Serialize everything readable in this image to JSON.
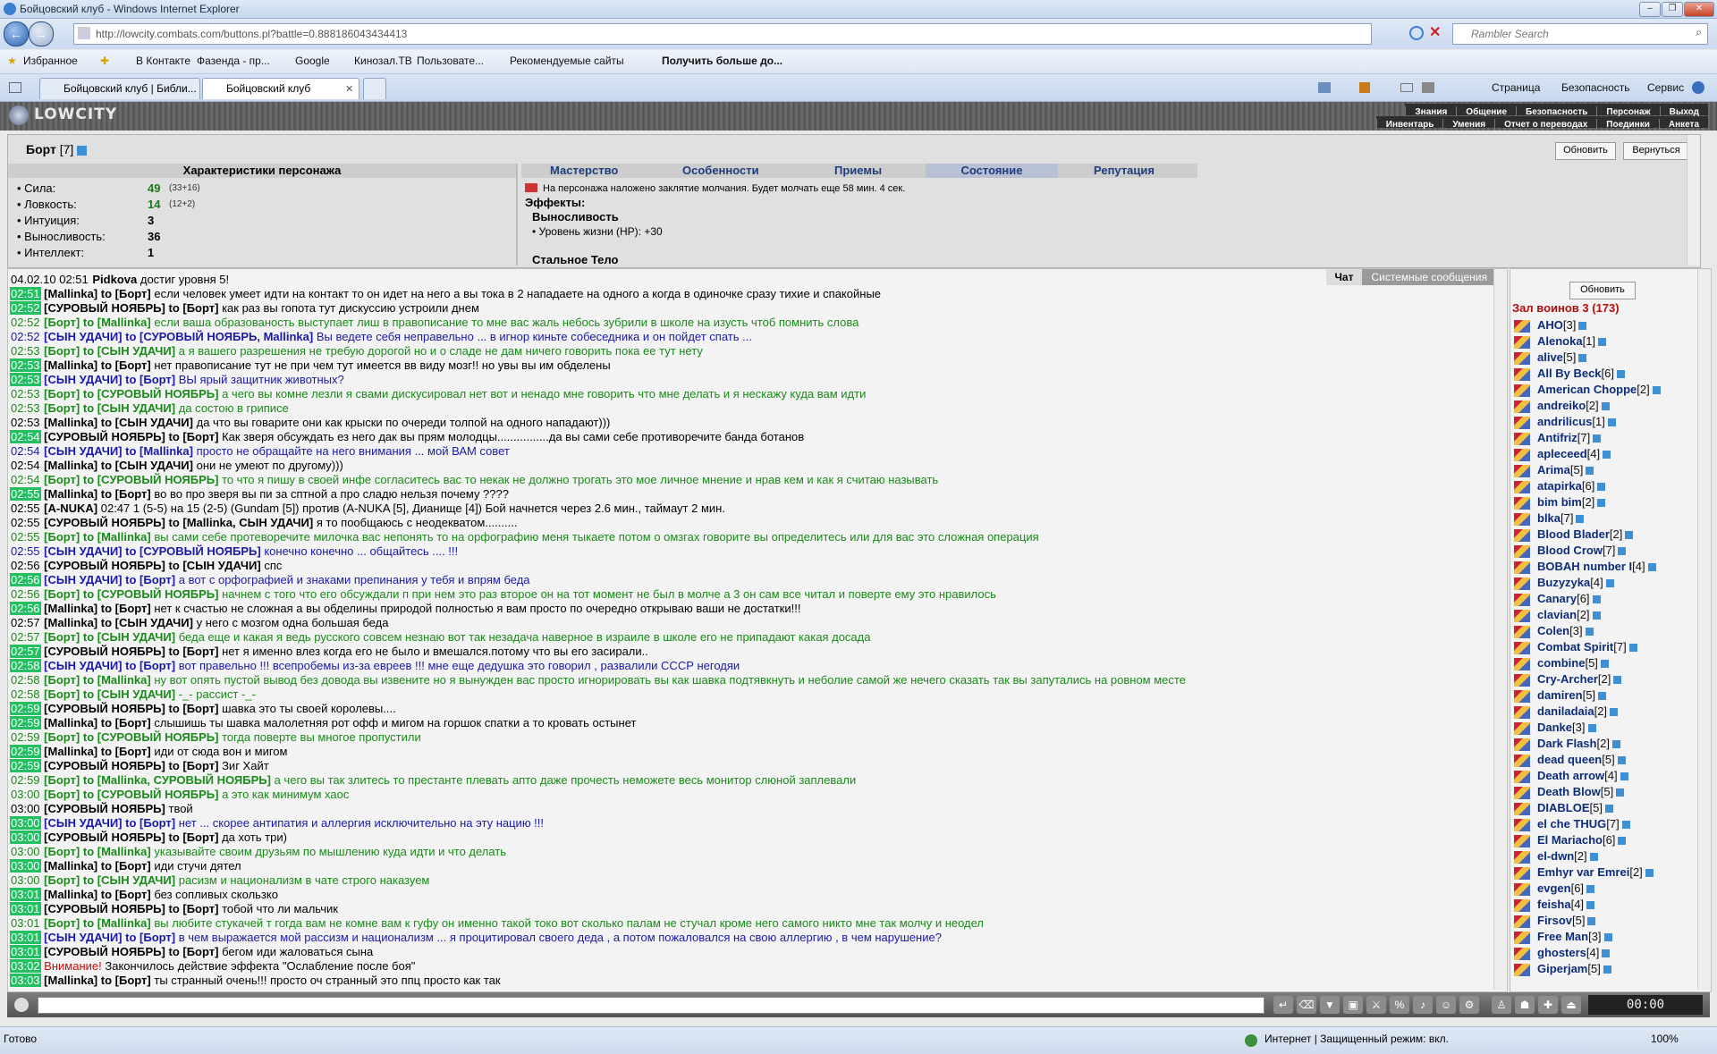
{
  "window": {
    "title": "Бойцовский клуб - Windows Internet Explorer"
  },
  "address": {
    "url": "http://lowcity.combats.com/buttons.pl?battle=0.888186043434413",
    "search_placeholder": "Rambler Search"
  },
  "favorites": {
    "label": "Избранное",
    "items": [
      "В Контакте",
      "Фазенда - пр...",
      "Google",
      "Кинозал.ТВ",
      "Пользовате...",
      "Рекомендуемые сайты",
      "Получить больше до..."
    ]
  },
  "tabs": [
    "Бойцовский клуб | Библи...",
    "Бойцовский клуб"
  ],
  "commands": [
    "Страница",
    "Безопасность",
    "Сервис"
  ],
  "game": {
    "logo": "LOWCITY",
    "menu_top": [
      "Знания",
      "Общение",
      "Безопасность",
      "Персонаж",
      "Выход"
    ],
    "menu_bottom": [
      "Инвентарь",
      "Умения",
      "Отчет о переводах",
      "Поединки",
      "Анкета"
    ]
  },
  "character": {
    "name": "Борт",
    "level": "[7]",
    "refresh_label": "Обновить",
    "back_label": "Вернуться",
    "stats_title": "Характеристики персонажа",
    "stats": [
      {
        "label": "• Сила:",
        "value": "49",
        "extra": "(33+16)"
      },
      {
        "label": "• Ловкость:",
        "value": "14",
        "extra": "(12+2)"
      },
      {
        "label": "• Интуиция:",
        "value": "3",
        "extra": ""
      },
      {
        "label": "• Выносливость:",
        "value": "36",
        "extra": ""
      },
      {
        "label": "• Интеллект:",
        "value": "1",
        "extra": ""
      }
    ],
    "tabs": [
      "Мастерство",
      "Особенности",
      "Приемы",
      "Состояние",
      "Репутация"
    ],
    "silence": "На персонажа наложено заклятие молчания. Будет молчать еще 58 мин. 4 сек.",
    "effects_title": "Эффекты:",
    "effect1": "Выносливость",
    "effect1_detail": "• Уровень жизни (HP): +30",
    "effect2": "Стальное Тело"
  },
  "chat": {
    "tabs": [
      "Чат",
      "Системные сообщения"
    ],
    "messages": [
      {
        "time": "04.02.10 02:51",
        "green": false,
        "name": "Pidkova",
        "to": "",
        "text": "достиг уровня 5!",
        "color": "#000"
      },
      {
        "time": "02:51",
        "green": true,
        "name": "[Mallinka]",
        "to": "to [Борт]",
        "text": "если человек умеет идти на контакт то он идет на него а вы тока в 2 нападаете на одного а когда в одиночке сразу тихие и спакойные",
        "color": "#000"
      },
      {
        "time": "02:52",
        "green": true,
        "name": "[СУРОВЫЙ НОЯБРЬ]",
        "to": "to [Борт]",
        "text": "как раз вы гопота тут дискуссию устроили днем",
        "color": "#000"
      },
      {
        "time": "02:52",
        "green": false,
        "name": "[Борт]",
        "to": "to [Mallinka]",
        "text": "если ваша образованость выступает лиш в правописание то мне вас жаль небось зубрили в школе на изусть чтоб помнить слова",
        "color": "#1a8a1a"
      },
      {
        "time": "02:52",
        "green": false,
        "name": "[СЫН УДАЧИ]",
        "to": "to [СУРОВЫЙ НОЯБРЬ, Mallinka]",
        "text": "Вы ведете себя неправельно ... в игнор киньте собеседника и он пойдет спать ...",
        "color": "#1a1aa8"
      },
      {
        "time": "02:53",
        "green": false,
        "name": "[Борт]",
        "to": "to [СЫН УДАЧИ]",
        "text": "а я вашего разрешения не требую дорогой но и о сладе не дам ничего говорить пока ее тут нету",
        "color": "#1a8a1a"
      },
      {
        "time": "02:53",
        "green": true,
        "name": "[Mallinka]",
        "to": "to [Борт]",
        "text": "нет правописание тут не при чем тут имеется вв виду мозг!! но увы вы им обделены",
        "color": "#000"
      },
      {
        "time": "02:53",
        "green": true,
        "name": "[СЫН УДАЧИ]",
        "to": "to [Борт]",
        "text": "ВЫ ярый защитник животных?",
        "color": "#1a1aa8"
      },
      {
        "time": "02:53",
        "green": false,
        "name": "[Борт]",
        "to": "to [СУРОВЫЙ НОЯБРЬ]",
        "text": "а чего вы комне лезли я свами дискусировал нет вот и ненадо мне говорить что мне делать и я нескажу куда вам идти",
        "color": "#1a8a1a"
      },
      {
        "time": "02:53",
        "green": false,
        "name": "[Борт]",
        "to": "to [СЫН УДАЧИ]",
        "text": "да состою в гриписе",
        "color": "#1a8a1a"
      },
      {
        "time": "02:53",
        "green": false,
        "name": "[Mallinka]",
        "to": "to [СЫН УДАЧИ]",
        "text": "да что вы говарите они как крыски по очереди толпой на одного нападают)))",
        "color": "#000"
      },
      {
        "time": "02:54",
        "green": true,
        "name": "[СУРОВЫЙ НОЯБРЬ]",
        "to": "to [Борт]",
        "text": "Как зверя обсуждать ез него дак вы прям молодцы................да вы сами себе противоречите банда ботанов",
        "color": "#000"
      },
      {
        "time": "02:54",
        "green": false,
        "name": "[СЫН УДАЧИ]",
        "to": "to [Mallinka]",
        "text": "просто не обращайте на него внимания ... мой ВАМ совет",
        "color": "#1a1aa8"
      },
      {
        "time": "02:54",
        "green": false,
        "name": "[Mallinka]",
        "to": "to [СЫН УДАЧИ]",
        "text": "они не умеют по другому)))",
        "color": "#000"
      },
      {
        "time": "02:54",
        "green": false,
        "name": "[Борт]",
        "to": "to [СУРОВЫЙ НОЯБРЬ]",
        "text": "то что я пишу в своей инфе согласитесь вас то некак не должно трогать это мое личное мнение и нрав кем и как я считаю называть",
        "color": "#1a8a1a"
      },
      {
        "time": "02:55",
        "green": true,
        "name": "[Mallinka]",
        "to": "to [Борт]",
        "text": "во во про зверя вы пи за сптной а про сладю нельзя почему ????",
        "color": "#000"
      },
      {
        "time": "02:55",
        "green": false,
        "name": "[A-NUKA]",
        "to": "",
        "text": "02:47 1 (5-5) на 15 (2-5) (Gundam [5]) против (A-NUKA [5], Дианище [4]) Бой начнется через 2.6 мин., таймаут 2 мин.",
        "color": "#000"
      },
      {
        "time": "02:55",
        "green": false,
        "name": "[СУРОВЫЙ НОЯБРЬ]",
        "to": "to [Mallinka, СЫН УДАЧИ]",
        "text": "я то пообщаюсь с неодекватом..........",
        "color": "#000"
      },
      {
        "time": "02:55",
        "green": false,
        "name": "[Борт]",
        "to": "to [Mallinka]",
        "text": "вы сами себе протеворечите милочка вас непонять то на орфографию меня тыкаете потом о омзгах говорите вы определитесь или для вас это сложная операция",
        "color": "#1a8a1a"
      },
      {
        "time": "02:55",
        "green": false,
        "name": "[СЫН УДАЧИ]",
        "to": "to [СУРОВЫЙ НОЯБРЬ]",
        "text": "конечно конечно ... общайтесь .... !!!",
        "color": "#1a1aa8"
      },
      {
        "time": "02:56",
        "green": false,
        "name": "[СУРОВЫЙ НОЯБРЬ]",
        "to": "to [СЫН УДАЧИ]",
        "text": "спс",
        "color": "#000"
      },
      {
        "time": "02:56",
        "green": true,
        "name": "[СЫН УДАЧИ]",
        "to": "to [Борт]",
        "text": "а вот с орфографией и знаками препинания у тебя и впрям беда",
        "color": "#1a1aa8"
      },
      {
        "time": "02:56",
        "green": false,
        "name": "[Борт]",
        "to": "to [СУРОВЫЙ НОЯБРЬ]",
        "text": "начнем с того что его обсуждали п при нем это раз второе он на тот момент не был в молче а 3 он сам все читал и поверте ему это нравилось",
        "color": "#1a8a1a"
      },
      {
        "time": "02:56",
        "green": true,
        "name": "[Mallinka]",
        "to": "to [Борт]",
        "text": "нет к счастью не сложная а вы обделины природой полностью я вам просто по очередно открываю ваши не достатки!!!",
        "color": "#000"
      },
      {
        "time": "02:57",
        "green": false,
        "name": "[Mallinka]",
        "to": "to [СЫН УДАЧИ]",
        "text": "у него с мозгом одна большая беда",
        "color": "#000"
      },
      {
        "time": "02:57",
        "green": false,
        "name": "[Борт]",
        "to": "to [СЫН УДАЧИ]",
        "text": "беда еще и какая я ведь русского совсем незнаю вот так незадача наверное в израиле в школе его не припадают какая досада",
        "color": "#1a8a1a"
      },
      {
        "time": "02:57",
        "green": true,
        "name": "[СУРОВЫЙ НОЯБРЬ]",
        "to": "to [Борт]",
        "text": "нет я именно влез когда его не было и вмешался.потому что вы его засирали..",
        "color": "#000"
      },
      {
        "time": "02:58",
        "green": true,
        "name": "[СЫН УДАЧИ]",
        "to": "to [Борт]",
        "text": "вот правельно !!! всепробемы из-за евреев !!! мне еще дедушка это говорил , развалили СССР негодяи",
        "color": "#1a1aa8"
      },
      {
        "time": "02:58",
        "green": false,
        "name": "[Борт]",
        "to": "to [Mallinka]",
        "text": "ну вот опять пустой вывод без довода вы извените но я вынужден вас просто игнорировать вы как шавка подтявкнуть и неболие самой же нечего сказать так вы запутались на ровном месте",
        "color": "#1a8a1a"
      },
      {
        "time": "02:58",
        "green": false,
        "name": "[Борт]",
        "to": "to [СЫН УДАЧИ]",
        "text": "-_- рассист -_-",
        "color": "#1a8a1a"
      },
      {
        "time": "02:59",
        "green": true,
        "name": "[СУРОВЫЙ НОЯБРЬ]",
        "to": "to [Борт]",
        "text": "шавка это ты своей королевы....",
        "color": "#000"
      },
      {
        "time": "02:59",
        "green": true,
        "name": "[Mallinka]",
        "to": "to [Борт]",
        "text": "слышишь ты шавка малолетняя рот офф и мигом на горшок спатки а то кровать остынет",
        "color": "#000"
      },
      {
        "time": "02:59",
        "green": false,
        "name": "[Борт]",
        "to": "to [СУРОВЫЙ НОЯБРЬ]",
        "text": "тогда поверте вы многое пропустили",
        "color": "#1a8a1a"
      },
      {
        "time": "02:59",
        "green": true,
        "name": "[Mallinka]",
        "to": "to [Борт]",
        "text": "иди от сюда вон и мигом",
        "color": "#000"
      },
      {
        "time": "02:59",
        "green": true,
        "name": "[СУРОВЫЙ НОЯБРЬ]",
        "to": "to [Борт]",
        "text": "Зиг Хайт",
        "color": "#000"
      },
      {
        "time": "02:59",
        "green": false,
        "name": "[Борт]",
        "to": "to [Mallinka, СУРОВЫЙ НОЯБРЬ]",
        "text": "а чего вы так злитесь то престанте плевать апто даже прочесть неможете весь монитор слюной заплевали",
        "color": "#1a8a1a"
      },
      {
        "time": "03:00",
        "green": false,
        "name": "[Борт]",
        "to": "to [СУРОВЫЙ НОЯБРЬ]",
        "text": "а это как минимум хаос",
        "color": "#1a8a1a"
      },
      {
        "time": "03:00",
        "green": false,
        "name": "[СУРОВЫЙ НОЯБРЬ]",
        "to": "",
        "text": "твой",
        "color": "#000"
      },
      {
        "time": "03:00",
        "green": true,
        "name": "[СЫН УДАЧИ]",
        "to": "to [Борт]",
        "text": "нет ... скорее антипатия и аллергия исключительно на эту нацию !!!",
        "color": "#1a1aa8"
      },
      {
        "time": "03:00",
        "green": true,
        "name": "[СУРОВЫЙ НОЯБРЬ]",
        "to": "to [Борт]",
        "text": "да хоть три)",
        "color": "#000"
      },
      {
        "time": "03:00",
        "green": false,
        "name": "[Борт]",
        "to": "to [Mallinka]",
        "text": "указывайте своим друзьям по мышлению куда идти и что делать",
        "color": "#1a8a1a"
      },
      {
        "time": "03:00",
        "green": true,
        "name": "[Mallinka]",
        "to": "to [Борт]",
        "text": "иди стучи дятел",
        "color": "#000"
      },
      {
        "time": "03:00",
        "green": false,
        "name": "[Борт]",
        "to": "to [СЫН УДАЧИ]",
        "text": "расизм и национализм в чате строго наказуем",
        "color": "#1a8a1a"
      },
      {
        "time": "03:01",
        "green": true,
        "name": "[Mallinka]",
        "to": "to [Борт]",
        "text": "без сопливых скользко",
        "color": "#000"
      },
      {
        "time": "03:01",
        "green": true,
        "name": "[СУРОВЫЙ НОЯБРЬ]",
        "to": "to [Борт]",
        "text": "тобой что ли мальчик",
        "color": "#000"
      },
      {
        "time": "03:01",
        "green": false,
        "name": "[Борт]",
        "to": "to [Mallinka]",
        "text": "вы любите стукачей т гогда вам не комне вам к гуфу он именно такой токо вот сколько палам не стучал кроме него самого никто мне так молчу и неодел",
        "color": "#1a8a1a"
      },
      {
        "time": "03:01",
        "green": true,
        "name": "[СЫН УДАЧИ]",
        "to": "to [Борт]",
        "text": "в чем выражается мой рассизм и национализм ... я процитировал своего деда , а потом пожаловался на свою аллергию , в чем нарушение?",
        "color": "#1a1aa8"
      },
      {
        "time": "03:01",
        "green": true,
        "name": "[СУРОВЫЙ НОЯБРЬ]",
        "to": "to [Борт]",
        "text": "бегом иди жаловаться сына",
        "color": "#000"
      },
      {
        "time": "03:02",
        "green": true,
        "name": "Внимание!",
        "to": "",
        "text": "Закончилось действие эффекта \"Ослабление после боя\"",
        "color": "#000"
      },
      {
        "time": "03:03",
        "green": true,
        "name": "[Mallinka]",
        "to": "to [Борт]",
        "text": "ты странный очень!!! просто оч странный это ппц просто как так",
        "color": "#000"
      }
    ]
  },
  "users_panel": {
    "refresh_label": "Обновить",
    "hall_title": "Зал воинов 3 (173)",
    "users": [
      {
        "name": "AHO",
        "level": "[3]"
      },
      {
        "name": "Alenoka",
        "level": "[1]"
      },
      {
        "name": "alive",
        "level": "[5]"
      },
      {
        "name": "All By Beck",
        "level": "[6]"
      },
      {
        "name": "American Choppe",
        "level": "[2]"
      },
      {
        "name": "andreiko",
        "level": "[2]"
      },
      {
        "name": "andrilicus",
        "level": "[1]"
      },
      {
        "name": "Antifriz",
        "level": "[7]"
      },
      {
        "name": "apleceed",
        "level": "[4]"
      },
      {
        "name": "Arima",
        "level": "[5]"
      },
      {
        "name": "atapirka",
        "level": "[6]"
      },
      {
        "name": "bim bim",
        "level": "[2]"
      },
      {
        "name": "blka",
        "level": "[7]"
      },
      {
        "name": "Blood Blader",
        "level": "[2]"
      },
      {
        "name": "Blood Crow",
        "level": "[7]"
      },
      {
        "name": "BOBAH number I",
        "level": "[4]"
      },
      {
        "name": "Buzyzyka",
        "level": "[4]"
      },
      {
        "name": "Canary",
        "level": "[6]"
      },
      {
        "name": "clavian",
        "level": "[2]"
      },
      {
        "name": "Colen",
        "level": "[3]"
      },
      {
        "name": "Combat Spirit",
        "level": "[7]"
      },
      {
        "name": "combine",
        "level": "[5]"
      },
      {
        "name": "Cry-Archer",
        "level": "[2]"
      },
      {
        "name": "damiren",
        "level": "[5]"
      },
      {
        "name": "daniladaia",
        "level": "[2]"
      },
      {
        "name": "Danke",
        "level": "[3]"
      },
      {
        "name": "Dark Flash",
        "level": "[2]"
      },
      {
        "name": "dead queen",
        "level": "[5]"
      },
      {
        "name": "Death arrow",
        "level": "[4]"
      },
      {
        "name": "Death Blow",
        "level": "[5]"
      },
      {
        "name": "DIABLOE",
        "level": "[5]"
      },
      {
        "name": "el che THUG",
        "level": "[7]"
      },
      {
        "name": "El Mariacho",
        "level": "[6]"
      },
      {
        "name": "el-dwn",
        "level": "[2]"
      },
      {
        "name": "Emhyr var Emrei",
        "level": "[2]"
      },
      {
        "name": "evgen",
        "level": "[6]"
      },
      {
        "name": "feisha",
        "level": "[4]"
      },
      {
        "name": "Firsov",
        "level": "[5]"
      },
      {
        "name": "Free Man",
        "level": "[3]"
      },
      {
        "name": "ghosters",
        "level": "[4]"
      },
      {
        "name": "Giperjam",
        "level": "[5]"
      }
    ]
  },
  "status": {
    "text": "Готово",
    "zone": "Интернет | Защищенный режим: вкл.",
    "zoom": "100%"
  }
}
